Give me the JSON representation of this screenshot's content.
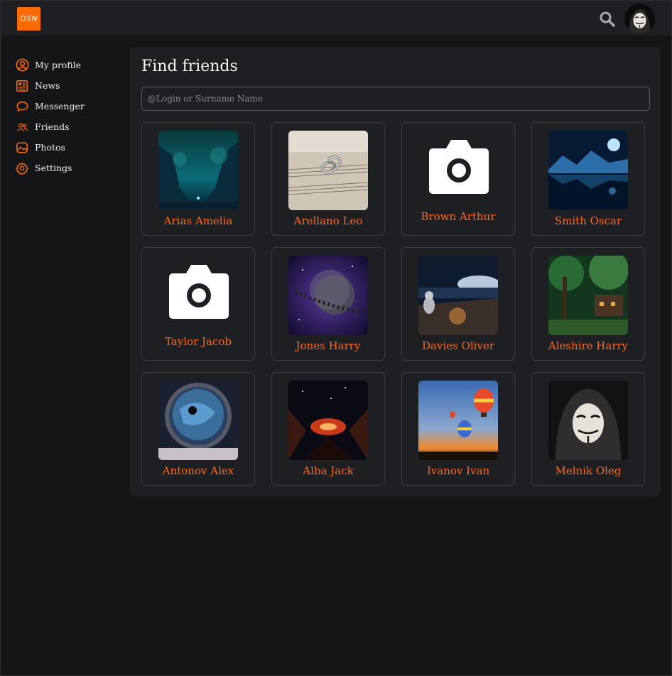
{
  "app": {
    "logo_text": "OSN"
  },
  "header": {
    "search_icon": "search-icon",
    "avatar": "user-avatar"
  },
  "sidebar": {
    "items": [
      {
        "label": "My profile",
        "icon": "user-circle-icon"
      },
      {
        "label": "News",
        "icon": "newspaper-icon"
      },
      {
        "label": "Messenger",
        "icon": "chat-bubble-icon"
      },
      {
        "label": "Friends",
        "icon": "users-icon"
      },
      {
        "label": "Photos",
        "icon": "image-icon"
      },
      {
        "label": "Settings",
        "icon": "gear-icon"
      }
    ]
  },
  "main": {
    "title": "Find friends",
    "search": {
      "placeholder": "@Login or Surname Name",
      "value": ""
    },
    "friends": [
      {
        "name": "Arias Amelia",
        "has_photo": true
      },
      {
        "name": "Arellano Leo",
        "has_photo": true
      },
      {
        "name": "Brown Arthur",
        "has_photo": false
      },
      {
        "name": "Smith Oscar",
        "has_photo": true
      },
      {
        "name": "Taylor Jacob",
        "has_photo": false
      },
      {
        "name": "Jones Harry",
        "has_photo": true
      },
      {
        "name": "Davies Oliver",
        "has_photo": true
      },
      {
        "name": "Aleshire Harry",
        "has_photo": true
      },
      {
        "name": "Antonov Alex",
        "has_photo": true
      },
      {
        "name": "Alba Jack",
        "has_photo": true
      },
      {
        "name": "Ivanov Ivan",
        "has_photo": true
      },
      {
        "name": "Melnik Oleg",
        "has_photo": true
      }
    ]
  },
  "colors": {
    "accent": "#ff6a00",
    "name_text": "#ff6a1a",
    "panel": "#1e1f22",
    "background": "#141517"
  }
}
